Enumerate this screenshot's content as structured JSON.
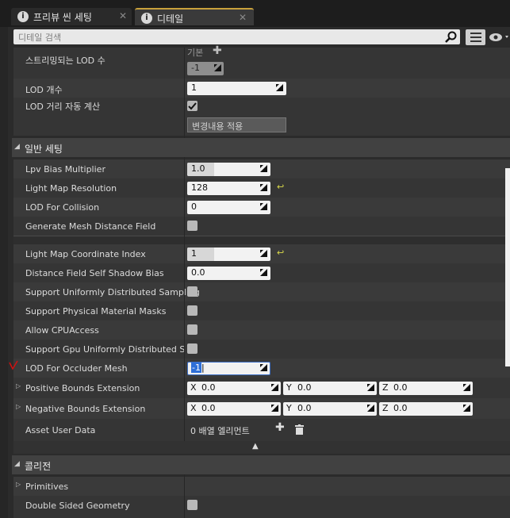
{
  "tabs": [
    {
      "label": "프리뷰 씬 세팅",
      "active": false
    },
    {
      "label": "디테일",
      "active": true
    }
  ],
  "search": {
    "placeholder": "디테일 검색"
  },
  "lod": {
    "streamed_lod_label": "스트리밍되는 LOD 수",
    "streamed_lod_default": "기본",
    "streamed_lod_value": "-1",
    "lod_count_label": "LOD 개수",
    "lod_count_value": "1",
    "auto_lod_label": "LOD 거리 자동 계산",
    "auto_lod_checked": true,
    "apply_changes_label": "변경내용 적용"
  },
  "general_section": {
    "title": "일반 세팅",
    "rows": [
      {
        "label": "Lpv Bias Multiplier",
        "value": "1.0"
      },
      {
        "label": "Light Map Resolution",
        "value": "128"
      },
      {
        "label": "LOD For Collision",
        "value": "0"
      },
      {
        "label": "Generate Mesh Distance Field"
      },
      {
        "label": "Light Map Coordinate Index",
        "value": "1"
      },
      {
        "label": "Distance Field Self Shadow Bias",
        "value": "0.0"
      },
      {
        "label": "Support Uniformly Distributed Sampling"
      },
      {
        "label": "Support Physical Material Masks"
      },
      {
        "label": "Allow CPUAccess"
      },
      {
        "label": "Support Gpu Uniformly Distributed Samp"
      },
      {
        "label": "LOD For Occluder Mesh",
        "value": "-1"
      },
      {
        "label": "Positive Bounds Extension",
        "x": "0.0",
        "y": "0.0",
        "z": "0.0"
      },
      {
        "label": "Negative Bounds Extension",
        "x": "0.0",
        "y": "0.0",
        "z": "0.0"
      },
      {
        "label": "Asset User Data",
        "value": "0 배열 엘리먼트"
      }
    ]
  },
  "axis": {
    "x": "X",
    "y": "Y",
    "z": "Z"
  },
  "collision_section": {
    "title": "콜리전",
    "rows": [
      {
        "label": "Primitives"
      },
      {
        "label": "Double Sided Geometry"
      }
    ]
  },
  "colors": {
    "accent": "#c9a13b",
    "selection": "#2e6fd8",
    "reset_arrow": "#d8d84a",
    "annotation": "#d01010"
  }
}
